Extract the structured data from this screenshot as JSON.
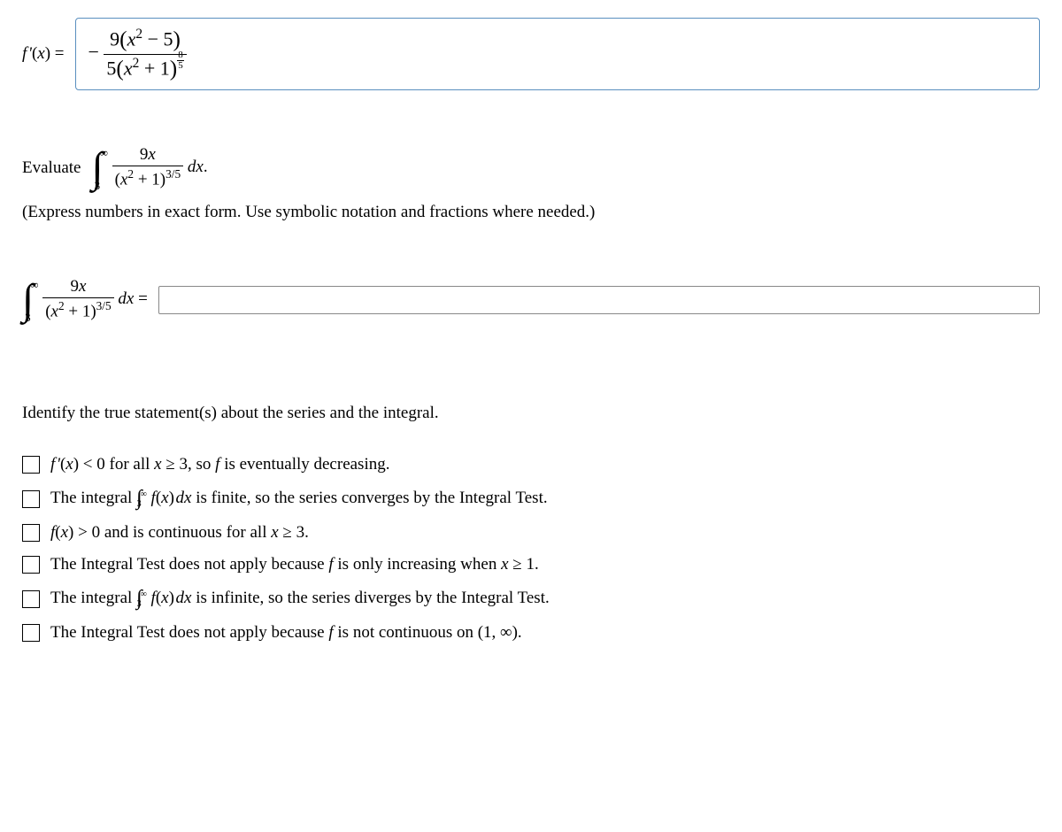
{
  "q1": {
    "lhs_html": "<span class='math'>f&#8202;'</span>(<span class='math'>x</span>) =",
    "answer_html": "&minus;&nbsp;<span class='frac'><span class='num'>9<span class='paren-lg'>(</span><span class='math'>x</span><sup>2</sup> &minus; 5<span class='paren-lg'>)</span></span><span class='den'>5<span class='paren-lg'>(</span><span class='math'>x</span><sup>2</sup> + 1<span class='paren-lg'>)</span><span class='sfrac'><span class='num'>8</span><span class='den'>5</span></span></span></span>"
  },
  "q2": {
    "eval_label": "Evaluate",
    "integral_html": "<span class='integral'><span class='int-sym'>&#8747;</span><span class='int-bounds'><span class='ub'>&infin;</span><span class='lb'>3</span></span></span>&nbsp;<span class='frac'><span class='num'>9<span class='math'>x</span></span><span class='den'>(<span class='math'>x</span><sup>2</sup> + 1)<sup>3/5</sup></span></span>&nbsp;<span class='math'>dx</span>.",
    "instr": "(Express numbers in exact form. Use symbolic notation and fractions where needed.)",
    "answer_lhs_html": "<span class='integral'><span class='int-sym'>&#8747;</span><span class='int-bounds'><span class='ub'>&infin;</span><span class='lb'>3</span></span></span>&nbsp;<span class='frac'><span class='num'>9<span class='math'>x</span></span><span class='den'>(<span class='math'>x</span><sup>2</sup> + 1)<sup>3/5</sup></span></span>&nbsp;<span class='math'>dx</span>&nbsp;="
  },
  "q3": {
    "prompt": "Identify the true statement(s) about the series and the integral.",
    "opts": [
      "<span class='math'>f&#8202;'</span>(<span class='math'>x</span>) &lt; 0 for all <span class='math'>x</span> &ge; 3, so <span class='math'>f</span> is eventually decreasing.",
      "The integral <span class='integral small-int'><span class='int-sym'>&#8747;</span><span class='int-bounds'><span class='ub'>&infin;</span><span class='lb'>3</span></span></span> <span class='math'>f</span>(<span class='math'>x</span>)&#8202;<span class='math'>dx</span> is finite, so the series converges by the Integral Test.",
      "<span class='math'>f</span>(<span class='math'>x</span>) &gt; 0 and is continuous for all <span class='math'>x</span> &ge; 3.",
      "The Integral Test does not apply because <span class='math'>f</span> is only increasing when <span class='math'>x</span> &ge; 1.",
      "The integral <span class='integral small-int'><span class='int-sym'>&#8747;</span><span class='int-bounds'><span class='ub'>&infin;</span><span class='lb'>3</span></span></span> <span class='math'>f</span>(<span class='math'>x</span>)&#8202;<span class='math'>dx</span> is infinite, so the series diverges by the Integral Test.",
      "The Integral Test does not apply because <span class='math'>f</span> is not continuous on (1, &infin;)."
    ]
  }
}
